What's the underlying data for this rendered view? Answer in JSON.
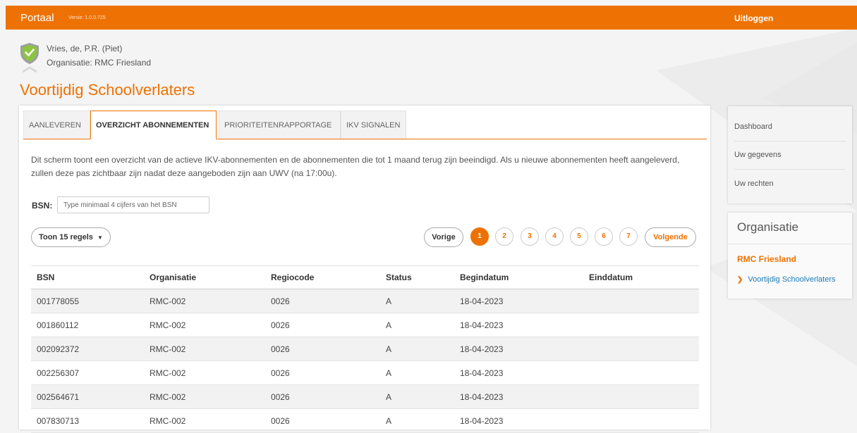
{
  "header": {
    "brand": "Portaal",
    "version": "Versie: 1.0.0.725",
    "logout_label": "Uitloggen",
    "color_primary": "#ee7203"
  },
  "user": {
    "name": "Vries, de, P.R. (Piet)",
    "organisation": "Organisatie: RMC Friesland",
    "icon": "shield-check-icon"
  },
  "page": {
    "title": "Voortijdig Schoolverlaters"
  },
  "tabs": [
    {
      "label": "AANLEVEREN",
      "active": false
    },
    {
      "label": "OVERZICHT ABONNEMENTEN",
      "active": true
    },
    {
      "label": "PRIORITEITENRAPPORTAGE",
      "active": false
    },
    {
      "label": "IKV SIGNALEN",
      "active": false
    }
  ],
  "content": {
    "intro": "Dit scherm toont een overzicht van de actieve IKV-abonnementen en de abonnementen die tot 1 maand terug zijn beeindigd. Als u nieuwe abonnementen heeft aangeleverd, zullen deze pas zichtbaar zijn nadat deze aangeboden zijn aan UWV (na 17:00u).",
    "bsn_label": "BSN:",
    "bsn_value": "",
    "bsn_placeholder": "Type minimaal 4 cijfers van het BSN",
    "rows_toggle": "Toon 15 regels",
    "pagination": {
      "prev": "Vorige",
      "next": "Volgende",
      "pages": [
        "1",
        "2",
        "3",
        "4",
        "5",
        "6",
        "7"
      ],
      "current": "1"
    }
  },
  "table": {
    "headers": [
      "BSN",
      "Organisatie",
      "Regiocode",
      "Status",
      "Begindatum",
      "Einddatum"
    ],
    "rows": [
      [
        "001778055",
        "RMC-002",
        "0026",
        "A",
        "18-04-2023",
        ""
      ],
      [
        "001860112",
        "RMC-002",
        "0026",
        "A",
        "18-04-2023",
        ""
      ],
      [
        "002092372",
        "RMC-002",
        "0026",
        "A",
        "18-04-2023",
        ""
      ],
      [
        "002256307",
        "RMC-002",
        "0026",
        "A",
        "18-04-2023",
        ""
      ],
      [
        "002564671",
        "RMC-002",
        "0026",
        "A",
        "18-04-2023",
        ""
      ],
      [
        "007830713",
        "RMC-002",
        "0026",
        "A",
        "18-04-2023",
        ""
      ]
    ]
  },
  "sidebar": {
    "menu": [
      "Dashboard",
      "Uw gegevens",
      "Uw rechten"
    ],
    "org_title": "Organisatie",
    "org_name": "RMC Friesland",
    "org_link": "Voortijdig Schoolverlaters"
  }
}
